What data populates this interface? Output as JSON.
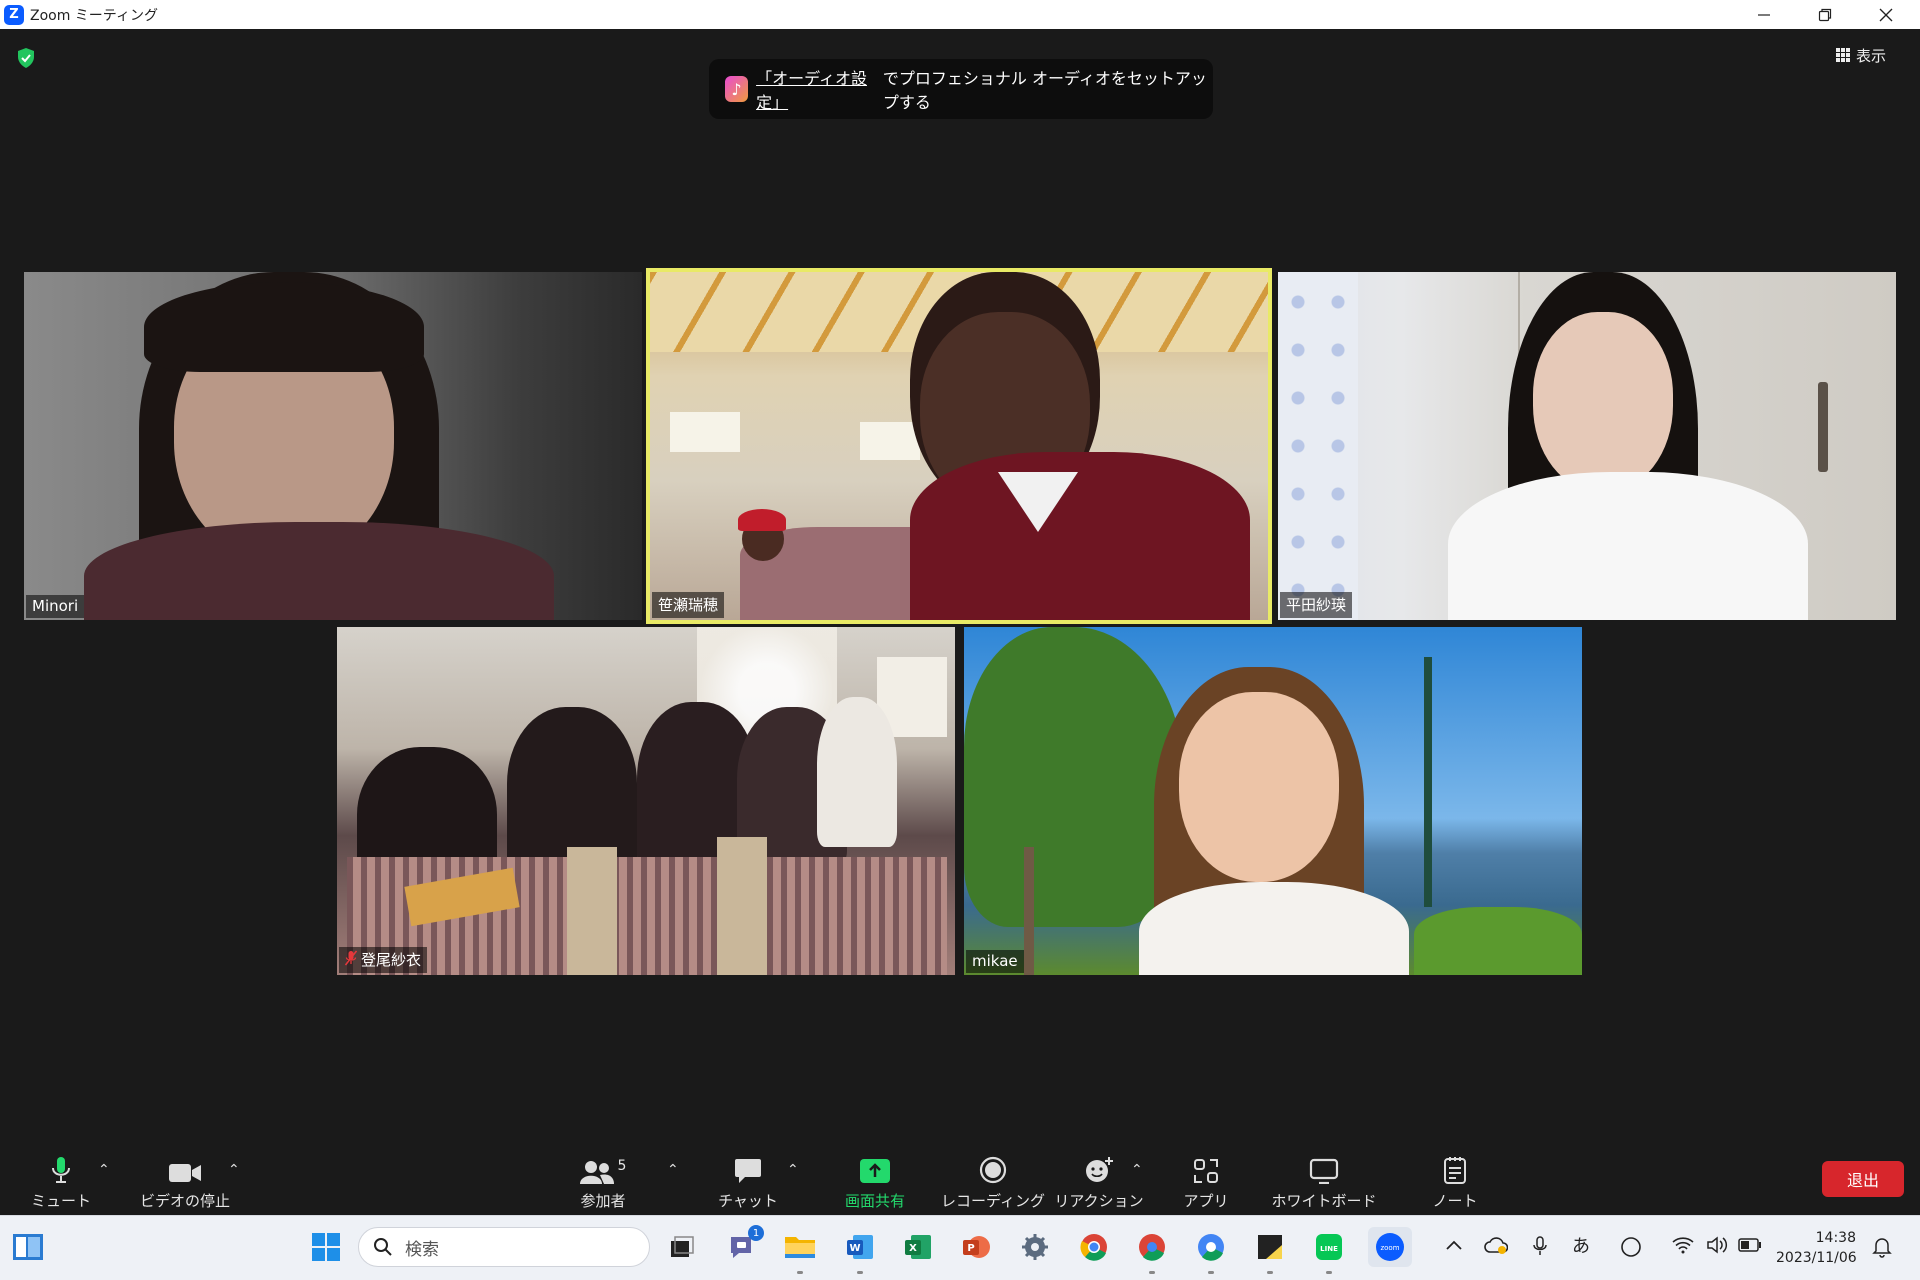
{
  "window": {
    "title": "Zoom ミーティング",
    "logo_letter": "Z"
  },
  "banner": {
    "link_text": "「オーディオ設定」",
    "rest_text": "でプロフェショナル オーディオをセットアップする"
  },
  "view_button": {
    "label": "表示"
  },
  "participants": [
    {
      "name": "Minori",
      "muted": false,
      "active": false
    },
    {
      "name": "笹瀬瑞穂",
      "muted": false,
      "active": true
    },
    {
      "name": "平田紗瑛",
      "muted": false,
      "active": false
    },
    {
      "name": "登尾紗衣",
      "muted": true,
      "active": false
    },
    {
      "name": "mikae",
      "muted": false,
      "active": false
    }
  ],
  "toolbar": {
    "mute": "ミュート",
    "stop_video": "ビデオの停止",
    "participants": "参加者",
    "participants_count": "5",
    "chat": "チャット",
    "share_screen": "画面共有",
    "recording": "レコーディング",
    "reactions": "リアクション",
    "apps": "アプリ",
    "whiteboard": "ホワイトボード",
    "notes": "ノート",
    "end": "退出"
  },
  "taskbar": {
    "search_placeholder": "検索",
    "teams_badge": "1",
    "ime": "あ",
    "time": "14:38",
    "date": "2023/11/06"
  },
  "colors": {
    "active_speaker": "#e9ea66",
    "share_green": "#23d96c",
    "end_red": "#d7262c"
  }
}
